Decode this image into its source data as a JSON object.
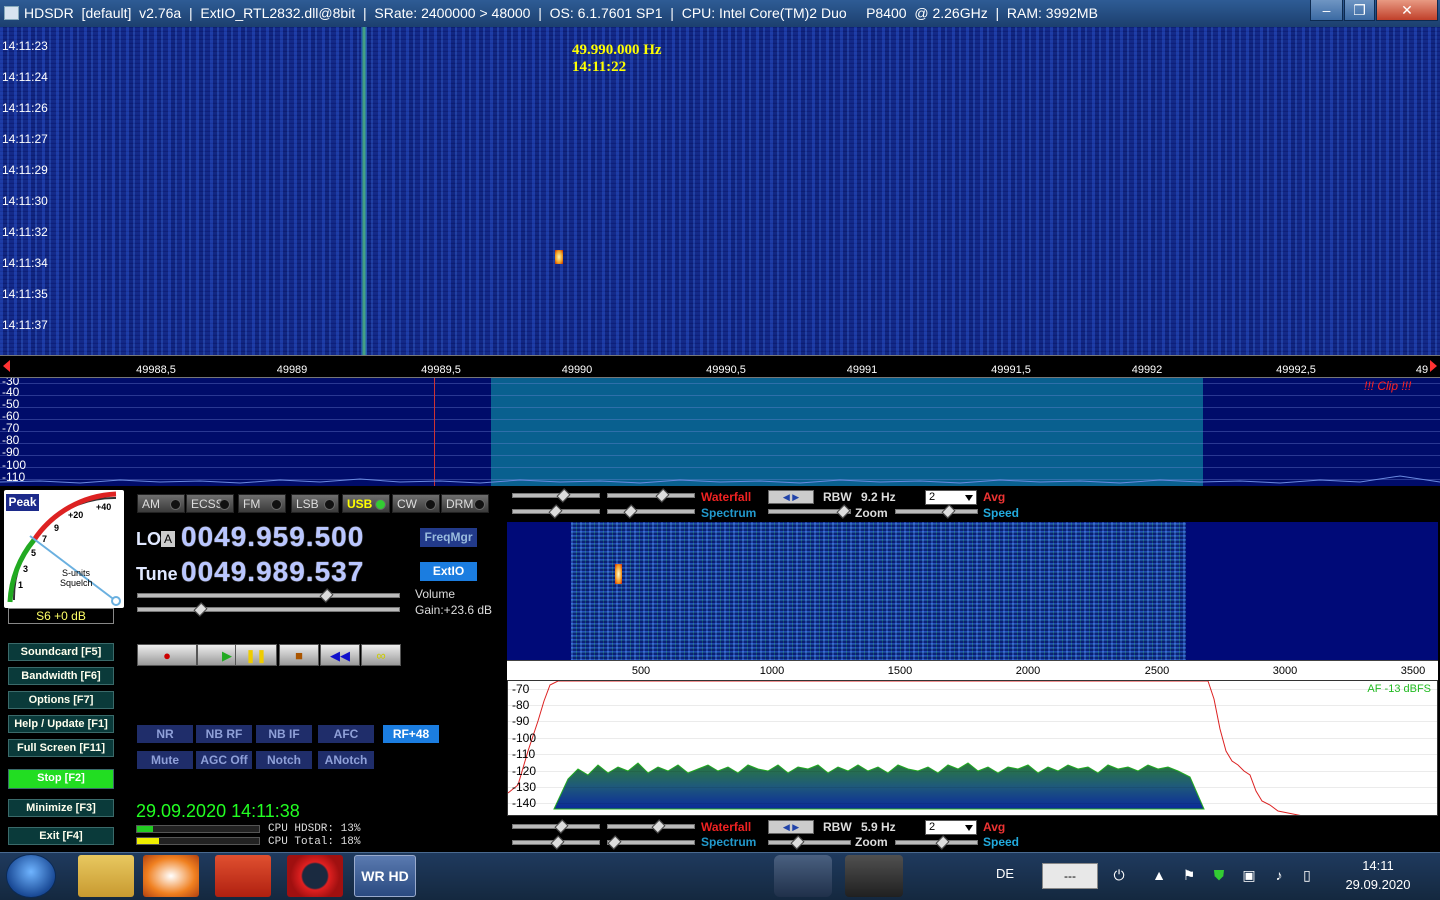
{
  "titlebar": {
    "title": "HDSDR  [default]  v2.76a  |  ExtIO_RTL2832.dll@8bit  |  SRate: 2400000 > 48000  |  OS: 6.1.7601 SP1  |  CPU: Intel Core(TM)2 Duo     P8400  @ 2.26GHz  |  RAM: 3992MB",
    "min": "–",
    "max": "❐",
    "close": "✕"
  },
  "waterfall": {
    "times": [
      "14:11:23",
      "14:11:24",
      "14:11:26",
      "14:11:27",
      "14:11:29",
      "14:11:30",
      "14:11:32",
      "14:11:34",
      "14:11:35",
      "14:11:37"
    ],
    "info_freq": "49.990.000 Hz",
    "info_time": "14:11:22"
  },
  "freq_axis": {
    "ticks": [
      "49988,5",
      "49989",
      "49989,5",
      "49990",
      "49990,5",
      "49991",
      "49991,5",
      "49992",
      "49992,5",
      "49"
    ]
  },
  "spectrum": {
    "labels": [
      "-30",
      "-40",
      "-50",
      "-60",
      "-70",
      "-80",
      "-90",
      "-100",
      "-110"
    ],
    "clip": "!!! Clip !!!"
  },
  "meter": {
    "peak": "Peak",
    "scale_a": "+40",
    "scale_b": "+20",
    "scale_9": "9",
    "scale_7": "7",
    "scale_5": "5",
    "scale_3": "3",
    "scale_1": "1",
    "label_sunits": "S-units",
    "label_squelch": "Squelch",
    "readout": "S6 +0 dB"
  },
  "fkeys": [
    {
      "label": "Soundcard  [F5]"
    },
    {
      "label": "Bandwidth  [F6]"
    },
    {
      "label": "Options  [F7]"
    },
    {
      "label": "Help / Update  [F1]"
    },
    {
      "label": "Full Screen  [F11]"
    },
    {
      "label": "Stop        [F2]"
    },
    {
      "label": "Minimize  [F3]"
    },
    {
      "label": "Exit       [F4]"
    }
  ],
  "modes": [
    "AM",
    "ECSS",
    "FM",
    "LSB",
    "USB",
    "CW",
    "DRM"
  ],
  "lo": {
    "label": "LO",
    "tag": "A",
    "value": "0049.959.500"
  },
  "tune": {
    "label": "Tune",
    "value": "0049.989.537"
  },
  "buttons": {
    "freqmgr": "FreqMgr",
    "extio": "ExtIO"
  },
  "volume": {
    "label": "Volume",
    "gain": "Gain:+23.6 dB"
  },
  "player": {
    "record": "●",
    "play": "▶",
    "pause": "❚❚",
    "stop": "■",
    "rewind": "◀◀",
    "loop": "∞"
  },
  "dsp": {
    "row1": [
      "NR",
      "NB RF",
      "NB IF",
      "AFC",
      "RF+48"
    ],
    "row2": [
      "Mute",
      "AGC Off",
      "Notch",
      "ANotch"
    ]
  },
  "clock": "29.09.2020 14:11:38",
  "cpu": {
    "hdsdr": "CPU HDSDR: 13%",
    "total": "CPU Total: 18%",
    "hdsdr_pct": 13,
    "total_pct": 18
  },
  "ctrl_top": {
    "waterfall": "Waterfall",
    "spectrum": "Spectrum",
    "rbw_label": "RBW",
    "rbw_value": "9.2 Hz",
    "zoom": "Zoom",
    "drop": "2",
    "avg": "Avg",
    "speed": "Speed"
  },
  "ctrl_bottom": {
    "waterfall": "Waterfall",
    "spectrum": "Spectrum",
    "rbw_label": "RBW",
    "rbw_value": "5.9 Hz",
    "zoom": "Zoom",
    "drop": "2",
    "avg": "Avg",
    "speed": "Speed"
  },
  "af_axis": {
    "ticks": [
      "500",
      "1000",
      "1500",
      "2000",
      "2500",
      "3000",
      "3500"
    ]
  },
  "af_spec": {
    "labels": [
      "-70",
      "-80",
      "-90",
      "-100",
      "-110",
      "-120",
      "-130",
      "-140"
    ],
    "level": "AF -13 dBFS"
  },
  "taskbar": {
    "lang": "DE",
    "box": "---",
    "time": "14:11",
    "date": "29.09.2020",
    "app_label": "WR HD"
  }
}
